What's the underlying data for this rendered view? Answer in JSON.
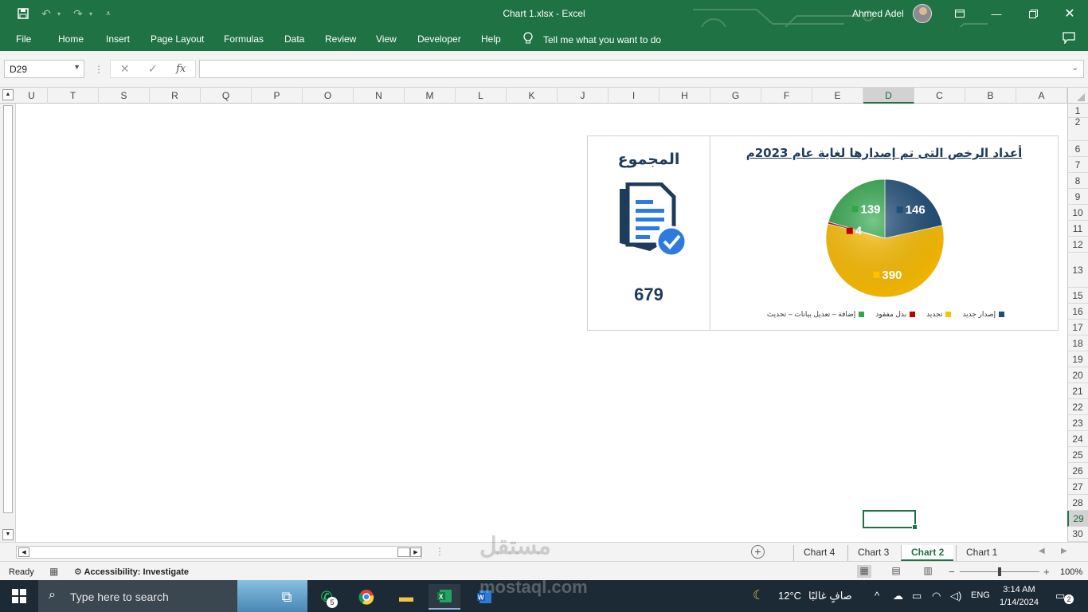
{
  "window": {
    "title": "Chart 1.xlsx  -  Excel",
    "user": "Ahmed Adel"
  },
  "ribbon": {
    "tabs": [
      "File",
      "Home",
      "Insert",
      "Page Layout",
      "Formulas",
      "Data",
      "Review",
      "View",
      "Developer",
      "Help"
    ],
    "tell_me": "Tell me what you want to do"
  },
  "formula_bar": {
    "name_box": "D29",
    "fx": "fx",
    "content": ""
  },
  "columns": [
    "U",
    "T",
    "S",
    "R",
    "Q",
    "P",
    "O",
    "N",
    "M",
    "L",
    "K",
    "J",
    "I",
    "H",
    "G",
    "F",
    "E",
    "D",
    "C",
    "B",
    "A"
  ],
  "selected_column": "D",
  "rows": [
    "1",
    "2",
    "6",
    "7",
    "8",
    "9",
    "10",
    "11",
    "12",
    "13",
    "15",
    "16",
    "17",
    "18",
    "19",
    "20",
    "21",
    "22",
    "23",
    "24",
    "25",
    "26",
    "27",
    "28",
    "29",
    "30"
  ],
  "selected_row": "29",
  "summary": {
    "title": "المجموع",
    "total": "679",
    "icon": "document-check-icon"
  },
  "chart_data": {
    "type": "pie",
    "title": "أعداد الرخص التى تم إصدارها لغاية عام 2023م",
    "slices": [
      {
        "name": "إصدار جديد",
        "value": 146,
        "color": "#1f4e79"
      },
      {
        "name": "تجديد",
        "value": 390,
        "color": "#ffc000"
      },
      {
        "name": "بدل مفقود",
        "value": 4,
        "color": "#c00000"
      },
      {
        "name": "إضافة – تعديل بيانات – تحديث",
        "value": 139,
        "color": "#2ea84a"
      }
    ],
    "legend_position": "bottom"
  },
  "sheet_tabs": [
    "Chart 4",
    "Chart 3",
    "Chart 2",
    "Chart 1"
  ],
  "active_sheet": "Chart 2",
  "status": {
    "ready": "Ready",
    "accessibility": "Accessibility: Investigate",
    "zoom": "100%"
  },
  "taskbar": {
    "search_placeholder": "Type here to search",
    "whatsapp_badge": "5",
    "weather_temp": "12°C",
    "weather_text": "صافٍ غالبًا",
    "lang": "ENG",
    "time": "3:14 AM",
    "date": "1/14/2024",
    "notif_count": "2"
  },
  "watermark": {
    "arabic": "مستقل",
    "latin": "mostaql.com"
  }
}
